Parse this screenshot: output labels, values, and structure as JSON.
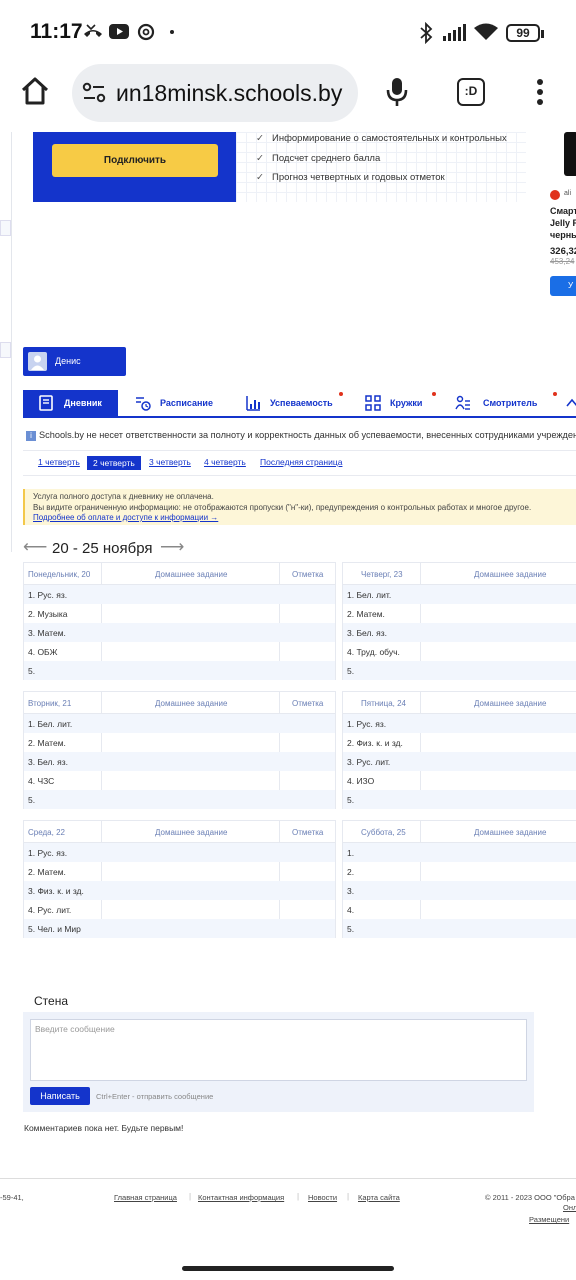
{
  "status": {
    "time": "11:17",
    "battery": "99"
  },
  "browser": {
    "url": "иn18minsk.schools.by"
  },
  "promo": {
    "connect_label": "Подключить",
    "features": [
      "Информирование о самостоятельных и контрольных",
      "Подсчет среднего балла",
      "Прогноз четвертных и годовых отметок"
    ]
  },
  "ad": {
    "brand": "ali",
    "line1": "Смарт",
    "line2": "Jelly P",
    "line3": "черны",
    "price": "326,32",
    "old_price": "453,24",
    "button": "У"
  },
  "user": {
    "name": "Денис"
  },
  "tabs": [
    {
      "label": "Дневник"
    },
    {
      "label": "Расписание"
    },
    {
      "label": "Успеваемость"
    },
    {
      "label": "Кружки"
    },
    {
      "label": "Смотритель"
    }
  ],
  "notice": "Schools.by не несет ответственности за полноту и корректность данных об успеваемости, внесенных сотрудниками учрежден",
  "quarters": [
    "1 четверть",
    "2 четверть",
    "3 четверть",
    "4 четверть",
    "Последняя страница"
  ],
  "warning": {
    "line1": "Услуга полного доступа к дневнику не оплачена.",
    "line2": "Вы видите ограниченную информацию: не отображаются пропуски (\"н\"-ки), предупреждения о контрольных работах и многое другое.",
    "link": "Подробнее об оплате и доступе к информации →"
  },
  "week": {
    "range": "20 - 25 ноября"
  },
  "diary": {
    "homework_header": "Домашнее задание",
    "mark_header": "Отметка",
    "days": [
      {
        "name": "Понедельник, 20",
        "lessons": [
          "1. Рус. яз.",
          "2. Музыка",
          "3. Матем.",
          "4. ОБЖ",
          "5."
        ]
      },
      {
        "name": "Четверг, 23",
        "lessons": [
          "1. Бел. лит.",
          "2. Матем.",
          "3. Бел. яз.",
          "4. Труд. обуч.",
          "5."
        ]
      },
      {
        "name": "Вторник, 21",
        "lessons": [
          "1. Бел. лит.",
          "2. Матем.",
          "3. Бел. яз.",
          "4. ЧЗС",
          "5."
        ]
      },
      {
        "name": "Пятница, 24",
        "lessons": [
          "1. Рус. яз.",
          "2. Физ. к. и зд.",
          "3. Рус. лит.",
          "4. ИЗО",
          "5."
        ]
      },
      {
        "name": "Среда, 22",
        "lessons": [
          "1. Рус. яз.",
          "2. Матем.",
          "3. Физ. к. и зд.",
          "4. Рус. лит.",
          "5. Чел. и Мир"
        ]
      },
      {
        "name": "Суббота, 25",
        "lessons": [
          "1.",
          "2.",
          "3.",
          "4.",
          "5."
        ]
      }
    ]
  },
  "wall": {
    "title": "Стена",
    "placeholder": "Введите сообщение",
    "submit": "Написать",
    "hint": "Ctrl+Enter - отправить сообщение",
    "no_comments": "Комментариев пока нет. Будьте первым!"
  },
  "footer": {
    "phone": "-59-41,",
    "links": [
      "Главная страница",
      "Контактная информация",
      "Новости",
      "Карта сайта"
    ],
    "copyright": "© 2011 - 2023 ООО \"Обра",
    "right_link1": "Онл",
    "right_link2": "Размещени"
  }
}
